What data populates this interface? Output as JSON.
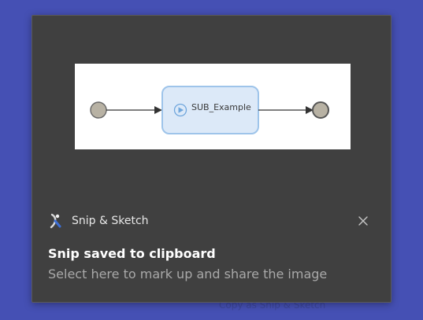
{
  "background_text": "Copy as Snip & Sketch",
  "notification": {
    "app_name": "Snip & Sketch",
    "title": "Snip saved to clipboard",
    "body": "Select here to mark up and share the image",
    "close_icon": "close-icon",
    "app_icon": "snip-and-sketch-icon"
  },
  "snip_preview": {
    "process_label": "SUB_Example",
    "start_event_icon": "start-event-circle",
    "end_event_icon": "end-event-circle",
    "subprocess_icon": "play-icon"
  },
  "colors": {
    "desktop_background": "#4550b4",
    "toast_background": "#404040",
    "subprocess_fill": "#dce9f8",
    "subprocess_border": "#9ec4ea",
    "event_fill": "#b8b2a4"
  }
}
